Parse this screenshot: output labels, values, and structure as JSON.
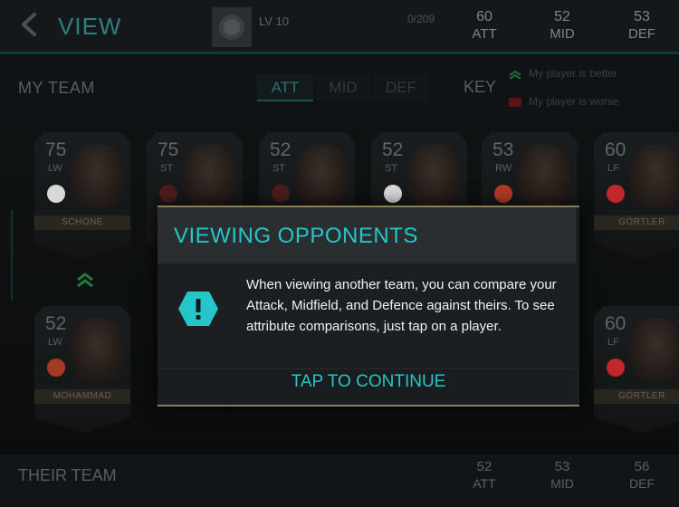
{
  "header": {
    "back_icon": "chevron-left-icon",
    "title": "VIEW",
    "club_badge_icon": "club-crest-icon",
    "level": "LV 10",
    "progress": "0/209",
    "stats": [
      {
        "value": "60",
        "label": "ATT"
      },
      {
        "value": "52",
        "label": "MID"
      },
      {
        "value": "53",
        "label": "DEF"
      }
    ]
  },
  "team_bar": {
    "title": "MY TEAM",
    "tabs": [
      "ATT",
      "MID",
      "DEF"
    ],
    "active_tab": "ATT",
    "key_label": "KEY",
    "legend": [
      {
        "icon": "double-chevron-up-icon",
        "text": "My player is better",
        "color": "#2a9a4a"
      },
      {
        "icon": "red-square-icon",
        "text": "My player is worse",
        "color": "#a31c1c"
      }
    ]
  },
  "my_cards": [
    {
      "rating": "75",
      "pos": "LW",
      "name": "SCHONE"
    },
    {
      "rating": "75",
      "pos": "ST",
      "name": ""
    },
    {
      "rating": "52",
      "pos": "ST",
      "name": ""
    },
    {
      "rating": "52",
      "pos": "ST",
      "name": ""
    },
    {
      "rating": "53",
      "pos": "RW",
      "name": ""
    },
    {
      "rating": "60",
      "pos": "LF",
      "name": "GÖRTLER"
    }
  ],
  "their_cards": [
    {
      "rating": "52",
      "pos": "LW",
      "name": "MOHAMMAD"
    },
    {
      "rating": "60",
      "pos": "LF",
      "name": "GÖRTLER"
    }
  ],
  "their_bar": {
    "title": "THEIR TEAM",
    "stats": [
      {
        "value": "52",
        "label": "ATT"
      },
      {
        "value": "53",
        "label": "MID"
      },
      {
        "value": "56",
        "label": "DEF"
      }
    ]
  },
  "modal": {
    "title": "VIEWING OPPONENTS",
    "icon": "exclamation-hexagon-icon",
    "body": "When viewing another team, you can compare your Attack, Midfield, and Defence against theirs. To see attribute comparisons, just tap on a player.",
    "button": "TAP TO CONTINUE"
  },
  "colors": {
    "accent": "#24c6c9",
    "gold_border": "#8a7d5a"
  }
}
